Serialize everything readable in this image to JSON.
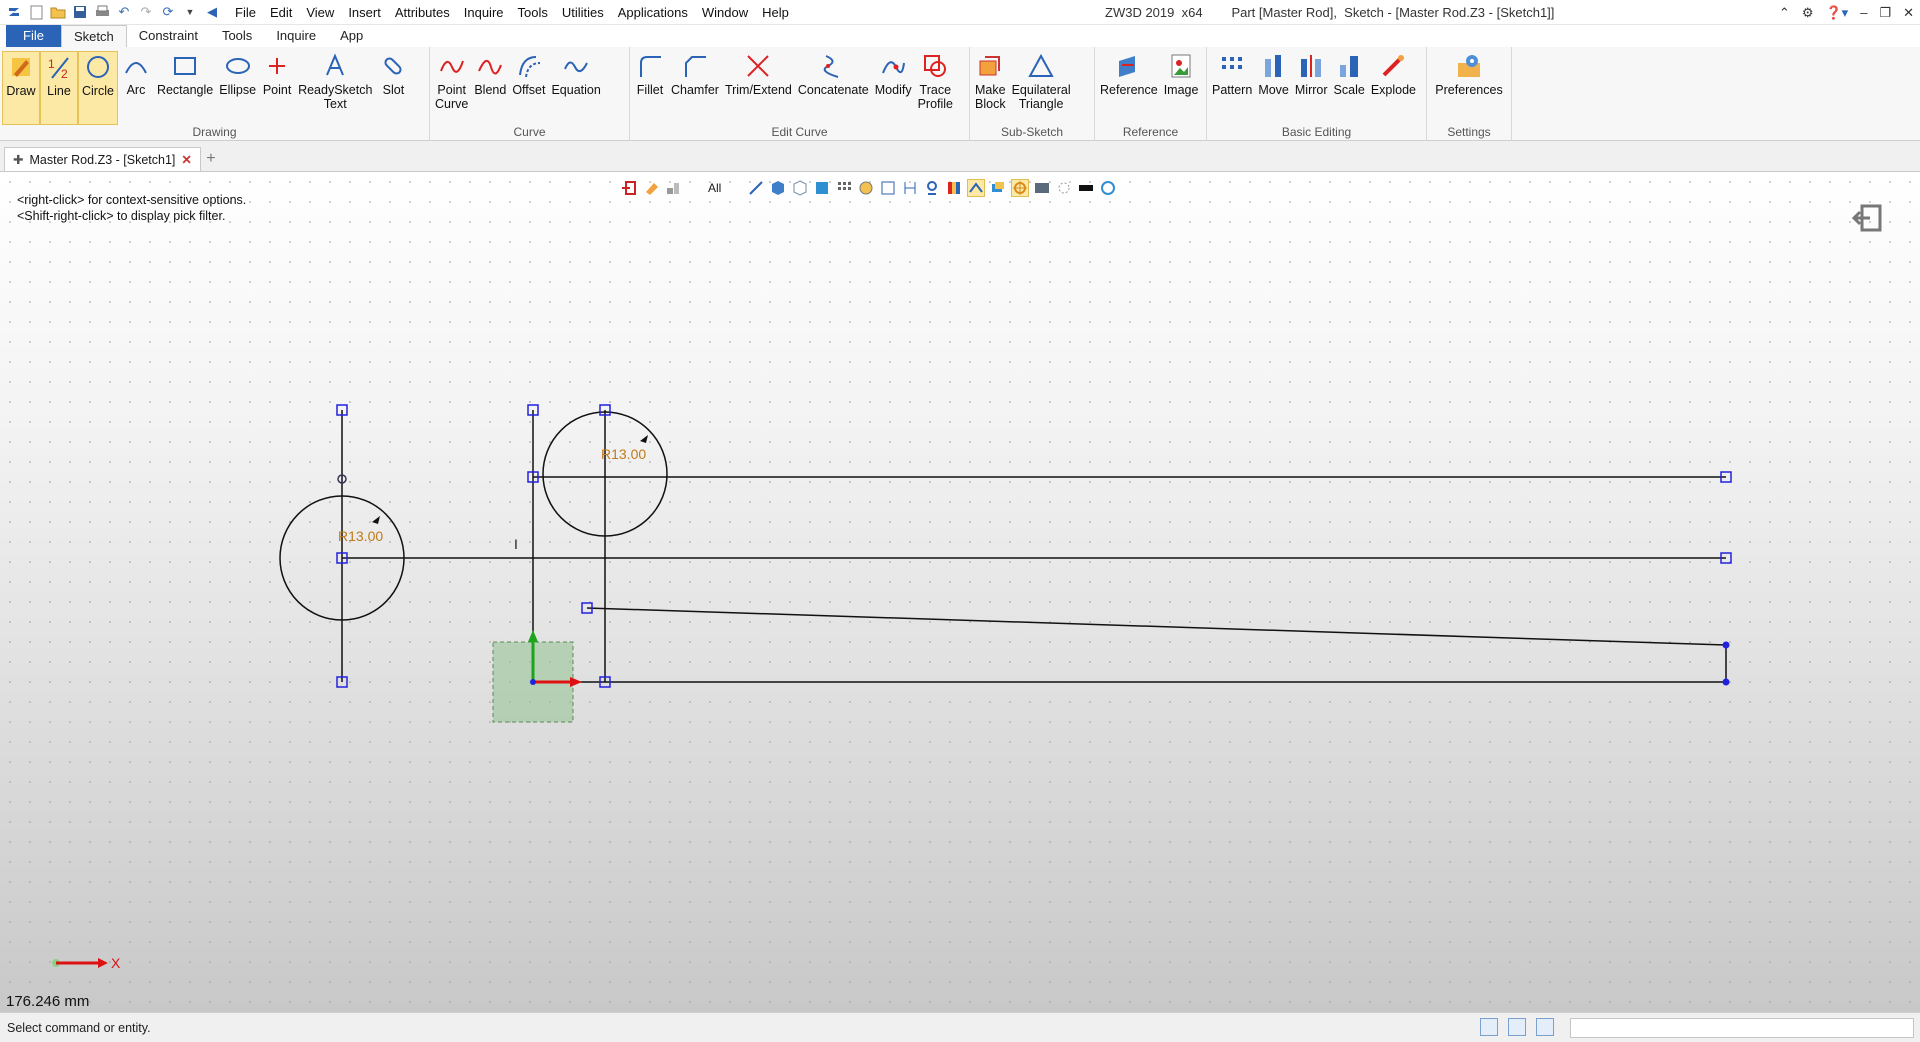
{
  "title_bar": {
    "app": "ZW3D 2019  x64",
    "doc": "Part [Master Rod],  Sketch - [Master Rod.Z3 - [Sketch1]]",
    "menu": [
      "File",
      "Edit",
      "View",
      "Insert",
      "Attributes",
      "Inquire",
      "Tools",
      "Utilities",
      "Applications",
      "Window",
      "Help"
    ]
  },
  "ribbon_tabs": [
    "File",
    "Sketch",
    "Constraint",
    "Tools",
    "Inquire",
    "App"
  ],
  "groups": {
    "drawing": {
      "label": "Drawing",
      "tools": [
        "Draw",
        "Line",
        "Circle",
        "Arc",
        "Rectangle",
        "Ellipse",
        "Point",
        "ReadySketch\nText",
        "Slot"
      ]
    },
    "curve": {
      "label": "Curve",
      "tools": [
        "Point\nCurve",
        "Blend",
        "Offset",
        "Equation"
      ]
    },
    "edit_curve": {
      "label": "Edit Curve",
      "tools": [
        "Fillet",
        "Chamfer",
        "Trim/Extend",
        "Concatenate",
        "Modify",
        "Trace\nProfile"
      ]
    },
    "sub_sketch": {
      "label": "Sub-Sketch",
      "tools": [
        "Make\nBlock",
        "Equilateral\nTriangle"
      ]
    },
    "reference": {
      "label": "Reference",
      "tools": [
        "Reference",
        "Image"
      ]
    },
    "basic_editing": {
      "label": "Basic Editing",
      "tools": [
        "Pattern",
        "Move",
        "Mirror",
        "Scale",
        "Explode"
      ]
    },
    "settings": {
      "label": "Settings",
      "tools": [
        "Preferences"
      ]
    }
  },
  "doc_tab": {
    "label": "Master Rod.Z3 - [Sketch1]"
  },
  "viewport": {
    "hint_line1": "<right-click> for context-sensitive options.",
    "hint_line2": "<Shift-right-click> to display pick filter.",
    "filter": "All",
    "dim1": "R13.00",
    "dim2": "R13.00",
    "cursor_mark": "I",
    "axis_label": "X",
    "measure": "176.246 mm"
  },
  "status": {
    "text": "Select command or entity."
  },
  "colors": {
    "file_tab": "#2b63b6",
    "highlight": "#fde9a6",
    "dim_text": "#c07a1a",
    "handle": "#2222dd"
  }
}
